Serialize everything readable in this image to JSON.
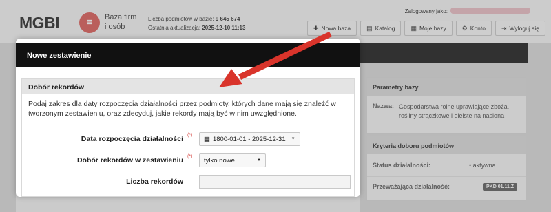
{
  "header": {
    "logo": "MGBI",
    "logo_mark": "≡",
    "logo_sub": "Baza firm i osób",
    "stats_label": "Liczba podmiotów w bazie:",
    "stats_value": "9 645 674",
    "update_label": "Ostatnia aktualizacja:",
    "update_value": "2025-12-10 11:13",
    "login_label": "Zalogowany jako:"
  },
  "nav": [
    {
      "icon": "plus-icon",
      "glyph": "✚",
      "label": "Nowa baza"
    },
    {
      "icon": "book-icon",
      "glyph": "▤",
      "label": "Katalog"
    },
    {
      "icon": "database-icon",
      "glyph": "▦",
      "label": "Moje bazy"
    },
    {
      "icon": "gear-icon",
      "glyph": "⚙",
      "label": "Konto"
    },
    {
      "icon": "logout-icon",
      "glyph": "⇥",
      "label": "Wyloguj się"
    }
  ],
  "modal": {
    "title": "Nowe zestawienie",
    "section_title": "Dobór rekordów",
    "description": "Podaj zakres dla daty rozpoczęcia działalności przez podmioty, których dane mają się znaleźć w tworzonym zestawieniu, oraz zdecyduj, jakie rekordy mają być w nim uwzględnione.",
    "fields": {
      "date": {
        "label": "Data rozpoczęcia działalności",
        "required": "(*)",
        "value": "1800-01-01 - 2025-12-31"
      },
      "selection": {
        "label": "Dobór rekordów w zestawieniu",
        "required": "(*)",
        "value": "tylko nowe"
      },
      "count": {
        "label": "Liczba rekordów",
        "value": ""
      }
    }
  },
  "side": {
    "params_title": "Parametry bazy",
    "name_key": "Nazwa:",
    "name_value": "Gospodarstwa rolne uprawiające zboża, rośliny strączkowe i oleiste na nasiona",
    "criteria_title": "Kryteria doboru podmiotów",
    "status_key": "Status działalności:",
    "status_value": "• aktywna",
    "activity_key": "Przeważająca działalność:",
    "activity_value": "PKD 01.11.Z"
  },
  "colors": {
    "accent": "#d9534f",
    "arrow": "#d9342b",
    "header_band": "#111111"
  }
}
